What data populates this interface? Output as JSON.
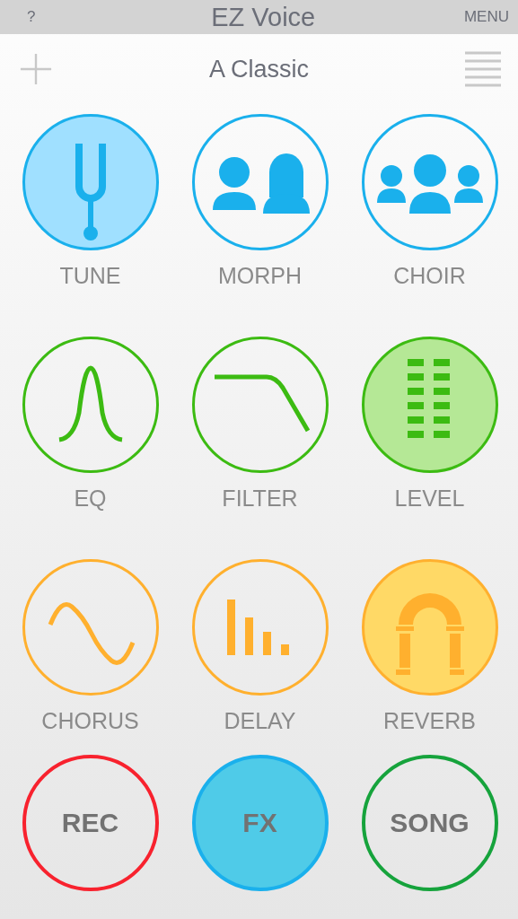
{
  "top_bar": {
    "help": "?",
    "title": "EZ Voice",
    "menu": "MENU"
  },
  "preset": {
    "name": "A Classic"
  },
  "effects": [
    {
      "label": "TUNE",
      "kind": "fork",
      "color": "#1ab0ec",
      "on": true
    },
    {
      "label": "MORPH",
      "kind": "pair",
      "color": "#1ab0ec",
      "on": false
    },
    {
      "label": "CHOIR",
      "kind": "group",
      "color": "#1ab0ec",
      "on": false
    },
    {
      "label": "EQ",
      "kind": "bell",
      "color": "#3cbb12",
      "on": false
    },
    {
      "label": "FILTER",
      "kind": "lowpass",
      "color": "#3cbb12",
      "on": false
    },
    {
      "label": "LEVEL",
      "kind": "meter",
      "color": "#3cbb12",
      "on": true
    },
    {
      "label": "CHORUS",
      "kind": "sine",
      "color": "#ffb02e",
      "on": false
    },
    {
      "label": "DELAY",
      "kind": "bars",
      "color": "#ffb02e",
      "on": false
    },
    {
      "label": "REVERB",
      "kind": "arch",
      "color": "#ffb02e",
      "on": true
    }
  ],
  "bottom_buttons": [
    {
      "label": "REC",
      "color": "#f8222e",
      "selected": false
    },
    {
      "label": "FX",
      "color": "#1ab0ec",
      "selected": true
    },
    {
      "label": "SONG",
      "color": "#16a33c",
      "selected": false
    }
  ]
}
